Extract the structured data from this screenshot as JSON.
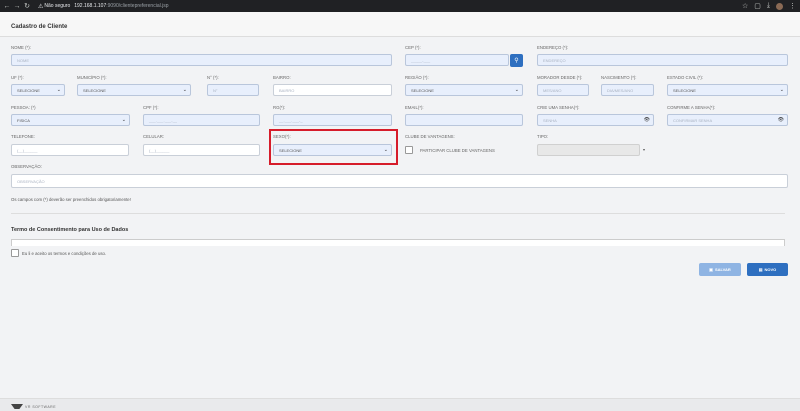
{
  "browser": {
    "insecure_label": "Não seguro",
    "url_host": "192.168.1.107",
    "url_rest": ":9090/clientepreferencial.jsp"
  },
  "page": {
    "title": "Cadastro de Cliente"
  },
  "labels": {
    "nome": "NOME (*):",
    "cep": "CEP (*):",
    "endereco": "ENDEREÇO (*):",
    "uf": "UF (*):",
    "municipio": "MUNICÍPIO (*):",
    "numero": "N° (*):",
    "bairro": "BAIRRO:",
    "regiao": "REGIÃO (*):",
    "morador": "MORADOR DESDE (*):",
    "nascimento": "NASCIMENTO (*):",
    "estado_civil": "ESTADO CIVIL (*):",
    "pessoa": "PESSOA: (*)",
    "cpf": "CPF (*):",
    "rg": "RG(*):",
    "email": "EMAIL(*):",
    "senha": "CRIE UMA SENHA(*):",
    "confirme": "CONFIRME A SENHA(*):",
    "telefone": "TELEFONE:",
    "celular": "CELULAR:",
    "sexo": "SEXO(*):",
    "clube": "CLUBE DE VANTAGENS:",
    "tipo": "TIPO:",
    "observacao": "OBSERVAÇÃO:"
  },
  "placeholders": {
    "nome": "NOME",
    "cep": "_____-___",
    "endereco": "ENDEREÇO",
    "uf": "SELECIONE",
    "municipio": "SELECIONE",
    "numero": "N°",
    "bairro": "BAIRRO",
    "regiao": "SELECIONE",
    "morador": "MES/ANO",
    "nascimento": "DIA/MES/ANO",
    "estado_civil": "SELECIONE",
    "pessoa": "FISICA",
    "cpf": "___.___.___-__",
    "rg": "__.___.___-_",
    "email": "",
    "senha": "SENHA",
    "confirme": "CONFIRMAR SENHA",
    "telefone": "(__)______",
    "celular": "(__)______",
    "sexo": "SELECIONE",
    "observacao": "OBSERVAÇÃO"
  },
  "clube_checkbox_label": "PARTICIPAR CLUBE DE VANTAGENS",
  "note": "Os campos com (*) deverão ser preenchidos obrigatoriamente!",
  "consent": {
    "title": "Termo de Consentimento para Uso de Dados",
    "accept_label": "Eu li e aceito os termos e condições de uso."
  },
  "buttons": {
    "save": "SALVAR",
    "new": "NOVO"
  },
  "footer": {
    "brand": "VR SOFTWARE"
  },
  "colors": {
    "primary": "#2e6fc0",
    "highlight": "#d61c2a"
  },
  "highlighted_field": "sexo"
}
